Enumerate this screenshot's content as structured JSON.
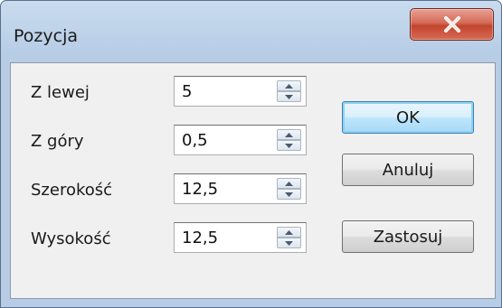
{
  "window": {
    "title": "Pozycja",
    "close_label": "x"
  },
  "fields": [
    {
      "label": "Z lewej",
      "value": "5"
    },
    {
      "label": "Z góry",
      "value": "0,5"
    },
    {
      "label": "Szerokość",
      "value": "12,5"
    },
    {
      "label": "Wysokość",
      "value": "12,5"
    }
  ],
  "buttons": {
    "ok": "OK",
    "cancel": "Anuluj",
    "apply": "Zastosuj"
  },
  "colors": {
    "close_button": "#c9482f",
    "default_button_border": "#3c7fb1",
    "client_background": "#f0f0f0"
  }
}
